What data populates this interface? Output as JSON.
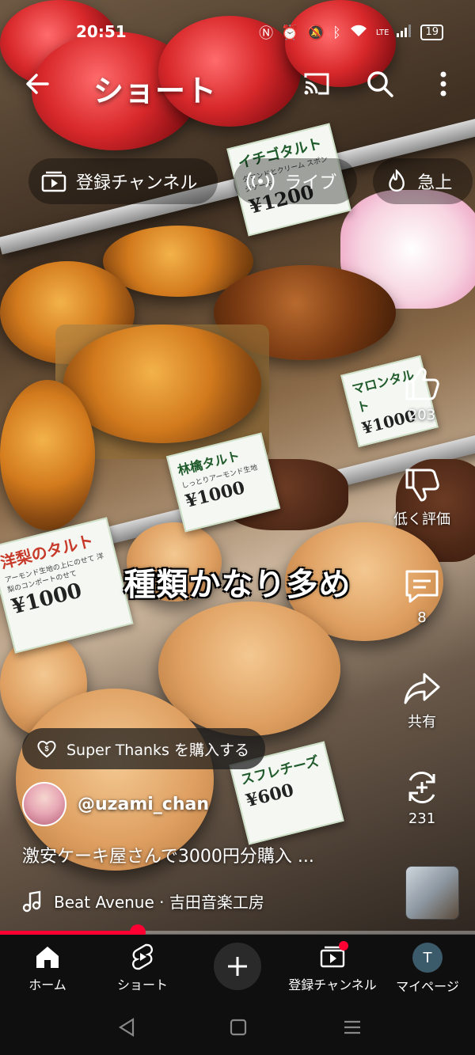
{
  "status_bar": {
    "time": "20:51",
    "battery": "19",
    "network": "LTE"
  },
  "header": {
    "title": "ショート"
  },
  "chips": [
    {
      "icon": "subscriptions-icon",
      "label": "登録チャンネル"
    },
    {
      "icon": "live-icon",
      "label": "ライブ"
    },
    {
      "icon": "trending-icon",
      "label": "急上"
    }
  ],
  "video": {
    "caption": "種類かなり多め",
    "price_cards": [
      {
        "name": "イチゴタルト",
        "sub": "ダマンドとクリーム スポンジケーキ",
        "price": "¥1200"
      },
      {
        "name": "マロンタルト",
        "sub": "",
        "price": "¥1000"
      },
      {
        "name": "林檎タルト",
        "sub": "しっとりアーモンド生地",
        "price": "¥1000"
      },
      {
        "name": "洋梨のタルト",
        "sub": "アーモンド生地の上にのせて 洋梨のコンポートのせて",
        "price": "¥1000"
      },
      {
        "name": "スフレチーズ",
        "sub": "",
        "price": "¥600"
      }
    ]
  },
  "actions": {
    "like_count": "203",
    "dislike_label": "低く評価",
    "comments_count": "8",
    "share_label": "共有",
    "remix_count": "231"
  },
  "info": {
    "super_thanks": "Super Thanks を購入する",
    "channel_handle": "@uzami_chan",
    "video_title": "激安ケーキ屋さんで3000円分購入 ...",
    "music": "Beat Avenue · 吉田音楽工房"
  },
  "progress": {
    "fraction": 0.29
  },
  "bottom_nav": {
    "home": "ホーム",
    "shorts": "ショート",
    "subscriptions": "登録チャンネル",
    "profile": "マイページ",
    "profile_initial": "T"
  },
  "colors": {
    "accent": "#ff0033",
    "nav_bg": "#0f0f0f"
  }
}
